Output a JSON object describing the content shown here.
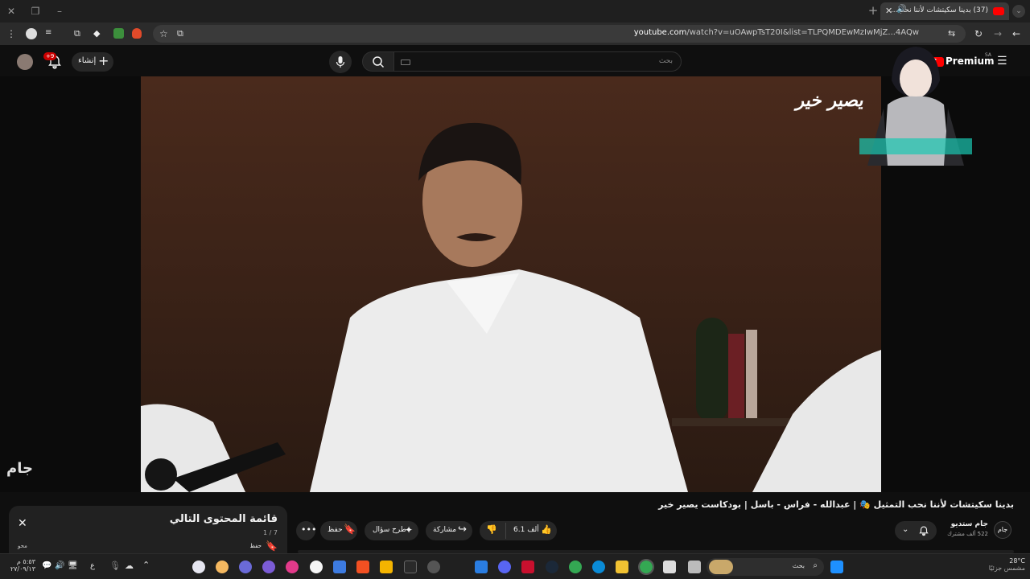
{
  "window": {
    "tab_title": "(37) بدينا سكيتشات لأننا نحب...",
    "minimize": "–",
    "restore": "❐",
    "new_tab": "+"
  },
  "address_bar": {
    "domain": "youtube.com",
    "path": "/watch?v=uOAwpTsT20I&list=TLPQMDEwMzIwMjZ...4AQw"
  },
  "header": {
    "logo_text": "Premium",
    "country": "SA",
    "search_placeholder": "بحث",
    "create_label": "إنشاء",
    "notification_count": "+9"
  },
  "video": {
    "watermark": "يصير خير",
    "corner_logo": "جام"
  },
  "details": {
    "title": "بدينا سكيتشات لأننا نحب التمثيل 🎭 | عبدالله - فراس - باسل | بودكاست يصير خير",
    "channel_name": "جام ستديو",
    "subscribers": "522 ألف مشترك",
    "likes": "6.1 ألف",
    "share_label": "مشاركة",
    "ask_label": "طرح سؤال",
    "save_label": "حفظ"
  },
  "playlist": {
    "title": "قائمة المحتوى التالي",
    "position": "1 / 7",
    "save_label": "حفظ",
    "owner": "محو"
  },
  "taskbar": {
    "search_placeholder": "بحث",
    "weather_temp": "28°C",
    "weather_desc": "مشمس جزئيًا",
    "time": "٥:٥٣ م",
    "date": "٢٧/٠٩/١٣",
    "lang": "ع"
  }
}
